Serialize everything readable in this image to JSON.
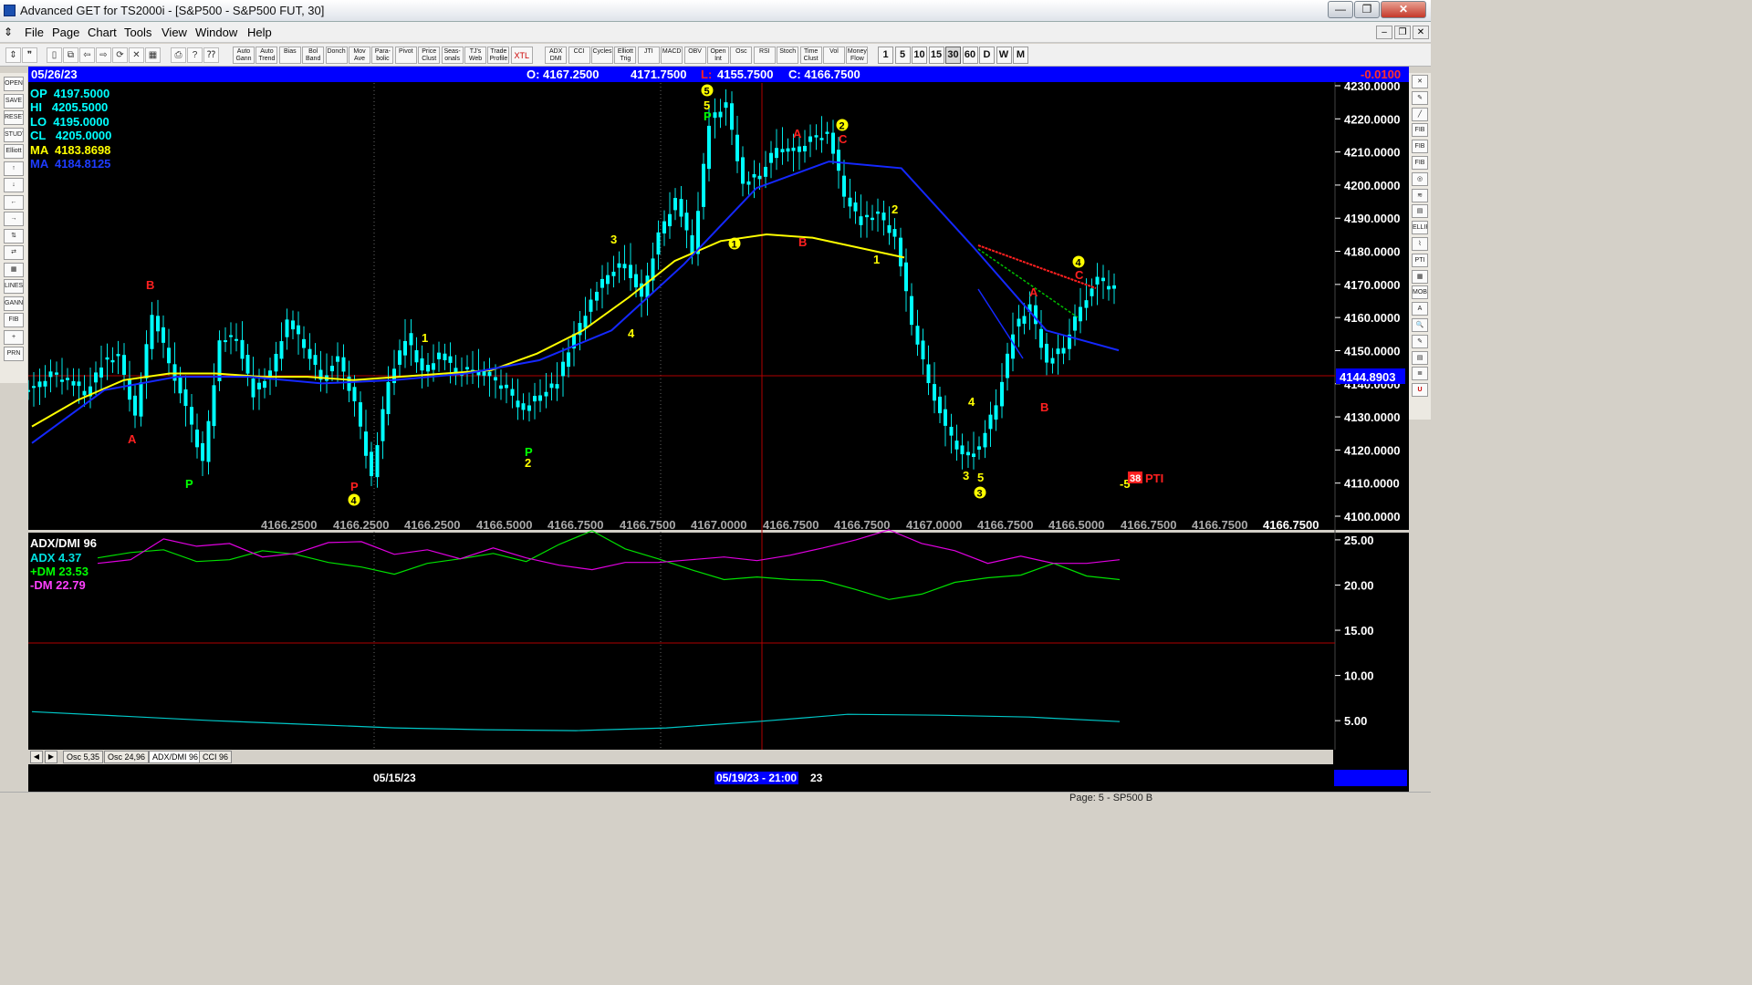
{
  "window": {
    "title": "Advanced GET for TS2000i - [S&P500 - S&P500 FUT, 30]",
    "min_glyph": "—",
    "max_glyph": "❐",
    "close_glyph": "✕"
  },
  "menu": [
    "File",
    "Page",
    "Chart",
    "Tools",
    "View",
    "Window",
    "Help"
  ],
  "mdi_controls": [
    "–",
    "❐",
    "✕"
  ],
  "toolbar": {
    "buttons": [
      "Auto Gann",
      "Auto Trend",
      "Bias",
      "Bol Band",
      "Donch",
      "Mov Ave",
      "Para-bolic",
      "Pivot",
      "Price Clust",
      "Seas-onals",
      "TJ's Web",
      "Trade Profile",
      "XTL",
      "ADX DMI",
      "CCI",
      "Cycles",
      "Elliott Trig",
      "JTI",
      "MACD",
      "OBV",
      "Open Int",
      "Osc",
      "RSI",
      "Stoch",
      "Time Clust",
      "Vol",
      "Money Flow"
    ],
    "intervals": [
      "1",
      "5",
      "10",
      "15",
      "30",
      "60",
      "D",
      "W",
      "M"
    ],
    "active_interval": "30"
  },
  "left_tools": [
    "OPEN",
    "SAVE",
    "RESET",
    "STUDY",
    "Elliott",
    "↑",
    "↓",
    "←",
    "→",
    "⇅",
    "⇄",
    "▦",
    "LINES",
    "GANN",
    "FIB",
    "+",
    "PRN"
  ],
  "right_tools": [
    "✕",
    "✎",
    "╱",
    "FIB RET",
    "FIB EXT",
    "FIB TIME",
    "◎",
    "≋",
    "▤",
    "ELLIPS",
    "⌇",
    "PTI",
    "▦",
    "MOB",
    "A",
    "🔍",
    "✎",
    "▤",
    "≣",
    "U"
  ],
  "infobar": {
    "date": "05/26/23",
    "open": "O: 4167.2500",
    "high": "4171.7500",
    "low_label": "L:",
    "low": "4155.7500",
    "close": "C: 4166.7500",
    "change": "-0.0100"
  },
  "readouts": [
    {
      "label": "OP  4197.5000",
      "color": "#00ffff"
    },
    {
      "label": "HI   4205.5000",
      "color": "#00ffff"
    },
    {
      "label": "LO  4195.0000",
      "color": "#00ffff"
    },
    {
      "label": "CL   4205.0000",
      "color": "#00ffff"
    },
    {
      "label": "MA  4183.8698",
      "color": "#ffff00"
    },
    {
      "label": "MA  4184.8125",
      "color": "#1e3cff"
    }
  ],
  "price_axis": {
    "ticks": [
      "4230.0000",
      "4220.0000",
      "4210.0000",
      "4200.0000",
      "4190.0000",
      "4180.0000",
      "4170.0000",
      "4160.0000",
      "4150.0000",
      "4140.0000",
      "4130.0000",
      "4120.0000",
      "4110.0000",
      "4100.0000"
    ],
    "last_price": "4144.8903"
  },
  "cursor_values": [
    "4166.2500",
    "4166.2500",
    "4166.2500",
    "4166.5000",
    "4166.7500",
    "4166.7500",
    "4167.0000",
    "4166.7500",
    "4166.7500",
    "4167.0000",
    "4166.7500",
    "4166.5000",
    "4166.7500",
    "4166.7500",
    "4166.7500"
  ],
  "chart_data": {
    "type": "line",
    "title": "S&P500 - S&P500 FUT, 30",
    "y_range": [
      4100,
      4230
    ],
    "price_approx": [
      4137,
      4142,
      4140,
      4136,
      4145,
      4147,
      4129,
      4160,
      4146,
      4131,
      4115,
      4152,
      4153,
      4136,
      4142,
      4158,
      4150,
      4141,
      4146,
      4133,
      4111,
      4140,
      4153,
      4142,
      4148,
      4142,
      4144,
      4140,
      4137,
      4131,
      4136,
      4140,
      4153,
      4164,
      4172,
      4176,
      4164,
      4184,
      4195,
      4179,
      4218,
      4223,
      4199,
      4202,
      4211,
      4208,
      4213,
      4215,
      4196,
      4188,
      4190,
      4183,
      4157,
      4140,
      4125,
      4117,
      4120,
      4133,
      4155,
      4162,
      4145,
      4150,
      4163,
      4170,
      4167
    ],
    "ma_yellow_approx": [
      4126,
      4134,
      4140,
      4142,
      4142,
      4141,
      4141,
      4140,
      4141,
      4142,
      4143,
      4148,
      4155,
      4165,
      4176,
      4182,
      4184,
      4183,
      4180,
      4177
    ],
    "ma_blue_approx": [
      4121,
      4137,
      4141,
      4141,
      4139,
      4140,
      4142,
      4146,
      4155,
      4175,
      4198,
      4206,
      4204,
      4180,
      4155,
      4149
    ],
    "elliott_labels": [
      {
        "text": "A",
        "color": "#ff2020"
      },
      {
        "text": "B",
        "color": "#ff2020"
      },
      {
        "text": "P",
        "color": "#00ff00"
      },
      {
        "text": "P",
        "color": "#ff2020"
      },
      {
        "text": "4",
        "color": "#ffff00"
      },
      {
        "text": "1",
        "color": "#ffff00"
      },
      {
        "text": "P",
        "color": "#00ff00"
      },
      {
        "text": "2",
        "color": "#ffff00"
      },
      {
        "text": "3",
        "color": "#ffff00"
      },
      {
        "text": "4",
        "color": "#ffff00"
      },
      {
        "text": "5",
        "color": "#ffff00"
      },
      {
        "text": "5",
        "color": "#ffff00"
      },
      {
        "text": "P",
        "color": "#00ff00"
      },
      {
        "text": "1",
        "color": "#ffff00"
      },
      {
        "text": "A",
        "color": "#ff2020"
      },
      {
        "text": "B",
        "color": "#ff2020"
      },
      {
        "text": "2",
        "color": "#ffff00"
      },
      {
        "text": "C",
        "color": "#ff2020"
      },
      {
        "text": "2",
        "color": "#ffff00"
      },
      {
        "text": "1",
        "color": "#ffff00"
      },
      {
        "text": "4",
        "color": "#ffff00"
      },
      {
        "text": "3",
        "color": "#ffff00"
      },
      {
        "text": "5",
        "color": "#ffff00"
      },
      {
        "text": "3",
        "color": "#ffff00"
      },
      {
        "text": "A",
        "color": "#ff2020"
      },
      {
        "text": "B",
        "color": "#ff2020"
      },
      {
        "text": "4",
        "color": "#ffff00"
      },
      {
        "text": "C",
        "color": "#ff2020"
      },
      {
        "text": "-5",
        "color": "#ffff00"
      }
    ],
    "pti": {
      "value": "38",
      "label": "PTI"
    }
  },
  "indicator": {
    "title": "ADX/DMI 96",
    "adx": "ADX 4.37",
    "plus_dm": "+DM 23.53",
    "minus_dm": "-DM 22.79",
    "ticks": [
      "25.00",
      "20.00",
      "15.00",
      "10.00",
      "5.00"
    ],
    "chart_data": {
      "type": "line",
      "y_range": [
        3,
        26
      ],
      "series": [
        {
          "name": "+DM",
          "color": "#00e000",
          "values": [
            23.0,
            23.6,
            23.9,
            22.6,
            22.8,
            23.8,
            23.4,
            22.5,
            22.0,
            21.2,
            22.4,
            22.9,
            23.5,
            22.6,
            24.5,
            26.0,
            24.0,
            22.9,
            21.7,
            20.6,
            20.9,
            20.6,
            20.5,
            19.5,
            18.4,
            19.0,
            20.3,
            20.8,
            21.1,
            22.4,
            21.0,
            20.6
          ]
        },
        {
          "name": "-DM",
          "color": "#e000e0",
          "values": [
            22.4,
            22.8,
            25.1,
            24.3,
            24.6,
            23.1,
            23.5,
            24.7,
            24.8,
            23.4,
            23.9,
            22.9,
            24.1,
            23.0,
            22.2,
            21.7,
            22.5,
            22.5,
            22.8,
            23.1,
            22.7,
            23.3,
            24.1,
            25.0,
            26.1,
            24.6,
            23.8,
            22.4,
            23.2,
            22.4,
            22.4,
            22.8
          ]
        },
        {
          "name": "ADX",
          "color": "#00c8c8",
          "values": [
            6.0,
            5.5,
            5.0,
            4.6,
            4.2,
            4.0,
            3.9,
            4.2,
            4.9,
            5.7,
            5.6,
            5.4,
            4.9
          ]
        }
      ]
    }
  },
  "tabs": [
    "Osc 5,35",
    "Osc 24,96",
    "ADX/DMI 96",
    "CCI 96"
  ],
  "active_tab": "ADX/DMI 96",
  "dates": {
    "left": "05/15/23",
    "cursor": "05/19/23 - 21:00",
    "cursor_suffix": "23"
  },
  "status": "Page: 5 - SP500 B"
}
